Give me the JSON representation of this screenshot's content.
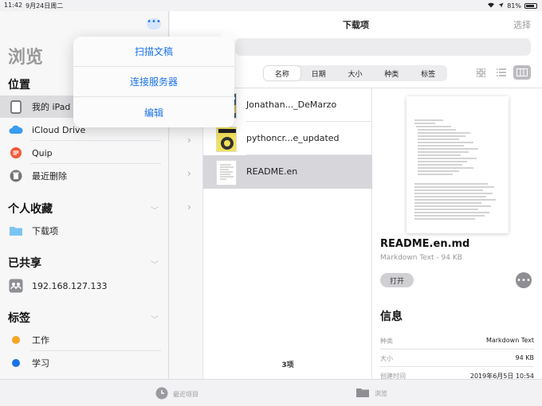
{
  "status": {
    "time": "11:42",
    "date": "9月24日周二",
    "battery": "81%"
  },
  "sidebar": {
    "title": "浏览",
    "more": "•••",
    "locations_title": "位置",
    "locations": [
      {
        "label": "我的 iPad",
        "icon": "ipad-icon"
      },
      {
        "label": "iCloud Drive",
        "icon": "cloud-icon"
      },
      {
        "label": "Quip",
        "icon": "quip-icon"
      },
      {
        "label": "最近删除",
        "icon": "trash-icon"
      }
    ],
    "favorites_title": "个人收藏",
    "favorites": [
      {
        "label": "下载项",
        "icon": "folder-icon"
      }
    ],
    "shared_title": "已共享",
    "shared": [
      {
        "label": "192.168.127.133",
        "icon": "server-icon"
      }
    ],
    "tags_title": "标签",
    "tags": [
      {
        "label": "工作",
        "color": "#f5a623"
      },
      {
        "label": "学习",
        "color": "#1a73e8"
      }
    ]
  },
  "popup": {
    "items": [
      "扫描文稿",
      "连接服务器",
      "编辑"
    ]
  },
  "main": {
    "title": "下载项",
    "choose": "选择",
    "sort_tabs": [
      "名称",
      "日期",
      "大小",
      "种类",
      "标签"
    ],
    "active_sort": "名称",
    "files": [
      {
        "name": "Jonathan..._DeMarzo"
      },
      {
        "name": "pythoncr...e_updated"
      },
      {
        "name": "README.en"
      }
    ],
    "count": "3项"
  },
  "detail": {
    "file_name": "README.en.md",
    "meta": "Markdown Text - 94 KB",
    "open": "打开",
    "info_title": "信息",
    "rows": [
      {
        "k": "种类",
        "v": "Markdown Text"
      },
      {
        "k": "大小",
        "v": "94 KB"
      },
      {
        "k": "创建时间",
        "v": "2019年6月5日 10:54"
      }
    ]
  },
  "tabbar": {
    "recent": "最近项目",
    "browse": "浏览"
  },
  "colors": {
    "accent": "#1a73e8",
    "selected_row": "#d6d6db"
  }
}
